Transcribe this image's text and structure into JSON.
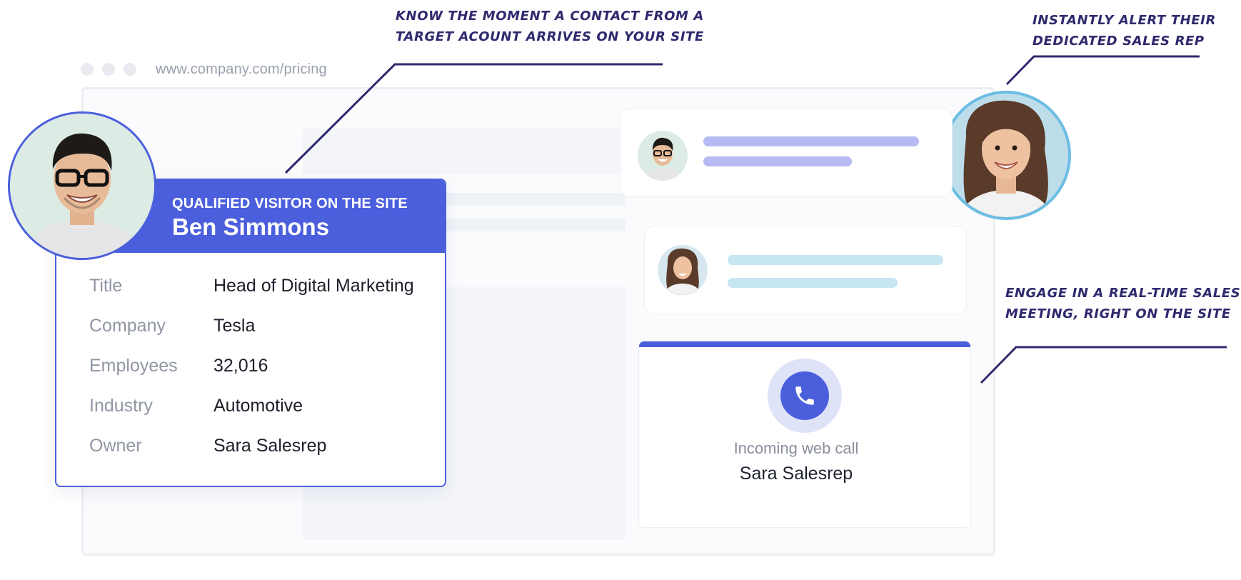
{
  "browser": {
    "url": "www.company.com/pricing"
  },
  "annotations": {
    "top_center": [
      "KNOW THE MOMENT A CONTACT FROM A",
      "TARGET ACOUNT ARRIVES ON YOUR SITE"
    ],
    "top_right": [
      "INSTANTLY ALERT THEIR",
      "DEDICATED SALES REP"
    ],
    "mid_right": [
      "ENGAGE IN A REAL-TIME SALES",
      "MEETING, RIGHT ON THE SITE"
    ]
  },
  "visitor_card": {
    "kicker": "QUALIFIED VISITOR ON THE SITE",
    "name": "Ben Simmons",
    "rows": [
      {
        "label": "Title",
        "value": "Head of Digital Marketing"
      },
      {
        "label": "Company",
        "value": "Tesla"
      },
      {
        "label": "Employees",
        "value": "32,016"
      },
      {
        "label": "Industry",
        "value": "Automotive"
      },
      {
        "label": "Owner",
        "value": "Sara Salesrep"
      }
    ]
  },
  "call": {
    "subtitle": "Incoming web call",
    "caller": "Sara Salesrep"
  },
  "colors": {
    "accent": "#4b5fdd",
    "annotation": "#2f2a6e",
    "bar_purple": "#b6baf3",
    "bar_blue": "#c6e6f3",
    "sara_ring": "#6bbde3"
  },
  "icons": [
    "phone-icon",
    "avatar-ben",
    "avatar-sara"
  ]
}
